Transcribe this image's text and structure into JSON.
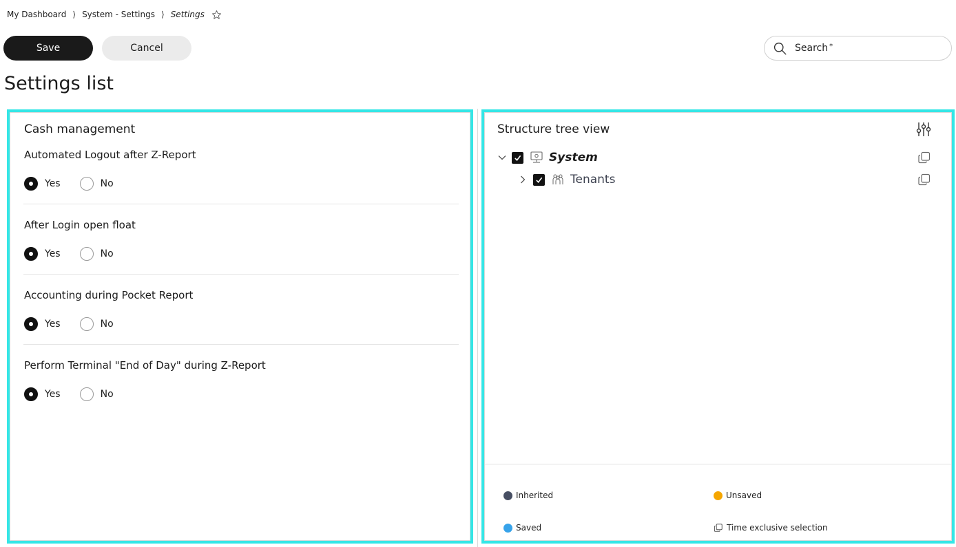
{
  "breadcrumb": {
    "items": [
      "My Dashboard",
      "System - Settings"
    ],
    "current": "Settings",
    "separator": "⟩"
  },
  "toolbar": {
    "save_label": "Save",
    "cancel_label": "Cancel"
  },
  "search": {
    "label": "Search",
    "required_mark": "*"
  },
  "page": {
    "title": "Settings list"
  },
  "settings_panel": {
    "title": "Cash management",
    "settings": [
      {
        "label": "Automated Logout after Z-Report",
        "options": [
          "Yes",
          "No"
        ],
        "selected": "Yes"
      },
      {
        "label": "After Login open float",
        "options": [
          "Yes",
          "No"
        ],
        "selected": "Yes"
      },
      {
        "label": "Accounting during Pocket Report",
        "options": [
          "Yes",
          "No"
        ],
        "selected": "Yes"
      },
      {
        "label": "Perform Terminal \"End of Day\" during Z-Report",
        "options": [
          "Yes",
          "No"
        ],
        "selected": "Yes"
      }
    ]
  },
  "tree_panel": {
    "title": "Structure tree view",
    "nodes": [
      {
        "label": "System",
        "expanded": true,
        "checked": true,
        "icon": "system-icon"
      },
      {
        "label": "Tenants",
        "expanded": false,
        "checked": true,
        "icon": "tenants-icon"
      }
    ],
    "legend": {
      "inherited": "Inherited",
      "unsaved": "Unsaved",
      "saved": "Saved",
      "time_exclusive": "Time exclusive selection"
    }
  },
  "colors": {
    "accent_frame": "#34e6e6",
    "inherited": "#474f63",
    "unsaved": "#f5a600",
    "saved": "#37a3ea",
    "primary_button": "#1a1a1a"
  }
}
